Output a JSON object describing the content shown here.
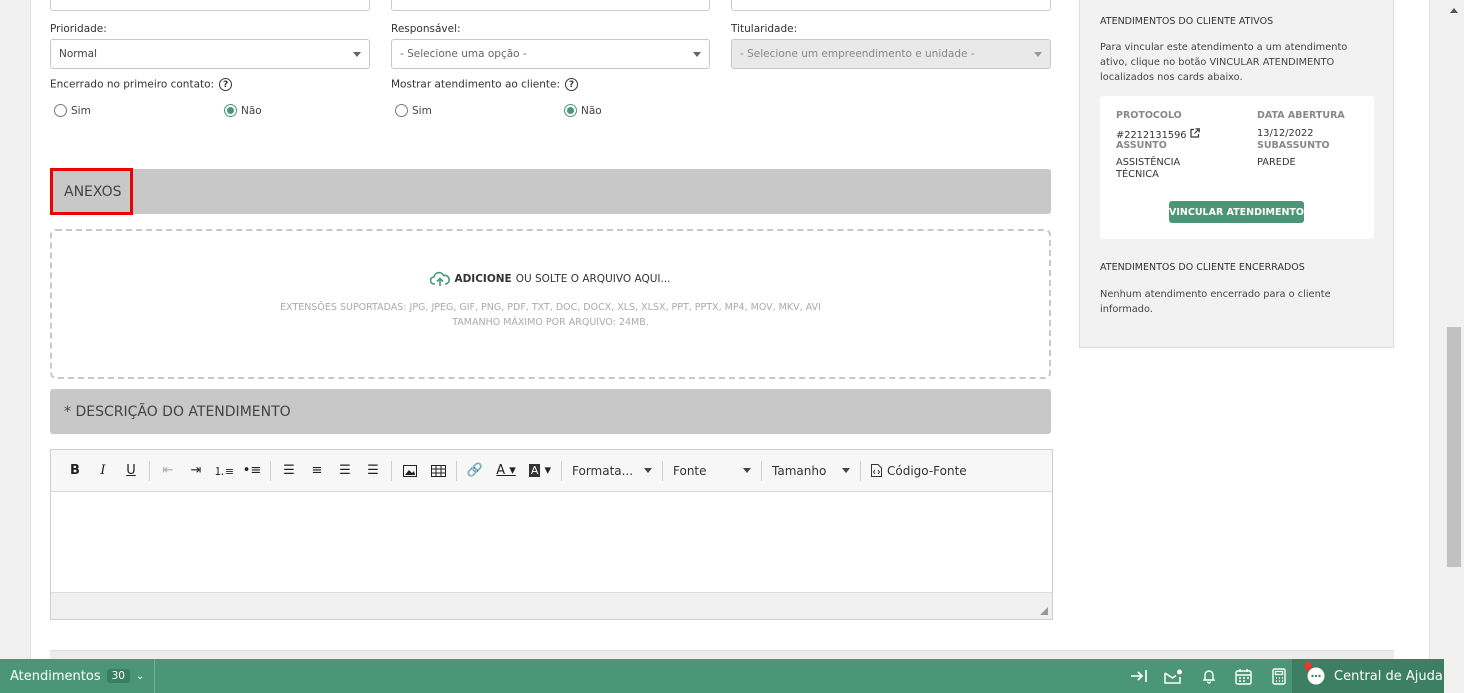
{
  "form": {
    "prioridade": {
      "label": "Prioridade:",
      "value": "Normal"
    },
    "responsavel": {
      "label": "Responsável:",
      "value": "- Selecione uma opção -"
    },
    "titularidade": {
      "label": "Titularidade:",
      "value": "- Selecione um empreendimento e unidade -"
    },
    "encerrado": {
      "label": "Encerrado no primeiro contato:",
      "help": "?",
      "opt_sim": "Sim",
      "opt_nao": "Não",
      "selected": "Não"
    },
    "mostrar": {
      "label": "Mostrar atendimento ao cliente:",
      "help": "?",
      "opt_sim": "Sim",
      "opt_nao": "Não",
      "selected": "Não"
    }
  },
  "anexos": {
    "title": "ANEXOS",
    "add_bold": "ADICIONE",
    "add_rest": "OU SOLTE O ARQUIVO AQUI...",
    "extensions": "EXTENSÕES SUPORTADAS: JPG, JPEG, GIF, PNG, PDF, TXT, DOC, DOCX, XLS, XLSX, PPT, PPTX, MP4, MOV, MKV, AVI",
    "max_size": "TAMANHO MÁXIMO POR ARQUIVO: 24MB."
  },
  "descricao": {
    "title": "* DESCRIÇÃO DO ATENDIMENTO",
    "toolbar": {
      "format": "Formata...",
      "font": "Fonte",
      "size": "Tamanho",
      "source": "Código-Fonte"
    }
  },
  "panel": {
    "ativos_title": "ATENDIMENTOS DO CLIENTE ATIVOS",
    "ativos_text": "Para vincular este atendimento a um atendimento ativo, clique no botão VINCULAR ATENDIMENTO localizados nos cards abaixo.",
    "card": {
      "protocolo_label": "PROTOCOLO",
      "protocolo_value": "#2212131596",
      "data_label": "DATA ABERTURA",
      "data_value": "13/12/2022",
      "assunto_label": "ASSUNTO",
      "assunto_value": "ASSISTÊNCIA TÉCNICA",
      "subassunto_label": "SUBASSUNTO",
      "subassunto_value": "PAREDE",
      "button": "VINCULAR ATENDIMENTO"
    },
    "encerrados_title": "ATENDIMENTOS DO CLIENTE ENCERRADOS",
    "encerrados_text": "Nenhum atendimento encerrado para o cliente informado."
  },
  "footer": {
    "atendimentos_label": "Atendimentos",
    "atendimentos_count": "30",
    "help_center": "Central de Ajuda"
  },
  "colors": {
    "accent": "#4a9676",
    "highlight": "#e00000",
    "section": "#c8c8c8"
  }
}
